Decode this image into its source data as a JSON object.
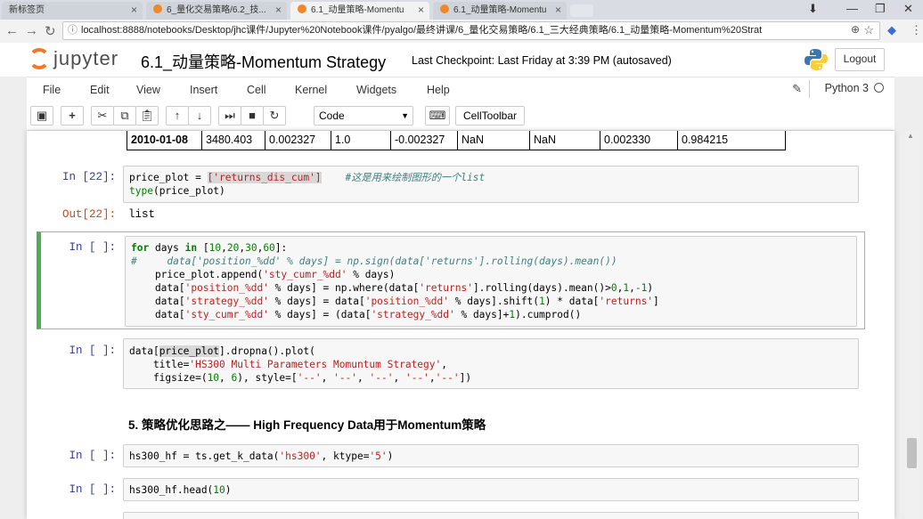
{
  "browser": {
    "tabs": [
      {
        "label": "新标签页",
        "active": false
      },
      {
        "label": "6_量化交易策略/6.2_技...",
        "active": false
      },
      {
        "label": "6.1_动量策略-Momentu",
        "active": true
      },
      {
        "label": "6.1_动量策略-Momentu",
        "active": false
      }
    ],
    "url": "localhost:8888/notebooks/Desktop/jhc课件/Jupyter%20Notebook课件/pyalgo/最终讲课/6_量化交易策略/6.1_三大经典策略/6.1_动量策略-Momentum%20Strat"
  },
  "header": {
    "logo_text": "jupyter",
    "notebook_title": "6.1_动量策略-Momentum Strategy",
    "checkpoint": "Last Checkpoint: Last Friday at 3:39 PM (autosaved)",
    "logout_label": "Logout"
  },
  "menu": {
    "items": [
      "File",
      "Edit",
      "View",
      "Insert",
      "Cell",
      "Kernel",
      "Widgets",
      "Help"
    ],
    "kernel_name": "Python 3"
  },
  "toolbar": {
    "cell_type": "Code",
    "celltoolbar_label": "CellToolbar"
  },
  "table_row": [
    "2010-01-08",
    "3480.403",
    "0.002327",
    "1.0",
    "-0.002327",
    "NaN",
    "NaN",
    "0.002330",
    "0.984215"
  ],
  "cells": {
    "c22_prompt": "In  [22]:",
    "c22_out_prompt": "Out[22]:",
    "c22_output": "list",
    "c_loop_prompt": "In  [  ]:",
    "c_plot_prompt": "In  [  ]:",
    "heading": "5. 策略优化思路之—— High Frequency Data用于Momentum策略",
    "c_hf_prompt": "In  [  ]:",
    "c_head_prompt": "In  [  ]:"
  },
  "code": {
    "c22": [
      "price_plot = ['returns_dis_cum']    #这是用来绘制图形的一个list",
      "type(price_plot)"
    ],
    "loop": [
      "for days in [10,20,30,60]:",
      "#     data['position_%dd' % days] = np.sign(data['returns'].rolling(days).mean())",
      "    price_plot.append('sty_cumr_%dd' % days)",
      "    data['position_%dd' % days] = np.where(data['returns'].rolling(days).mean()>0,1,-1)",
      "    data['strategy_%dd' % days] = data['position_%dd' % days].shift(1) * data['returns']",
      "    data['sty_cumr_%dd' % days] = (data['strategy_%dd' % days]+1).cumprod()"
    ],
    "plot": [
      "data[price_plot].dropna().plot(",
      "    title='HS300 Multi Parameters Momuntum Strategy',",
      "    figsize=(10, 6), style=['--', '--', '--', '--','--'])"
    ],
    "hf": "hs300_hf = ts.get_k_data('hs300', ktype='5')",
    "head": "hs300_hf.head(10)"
  }
}
